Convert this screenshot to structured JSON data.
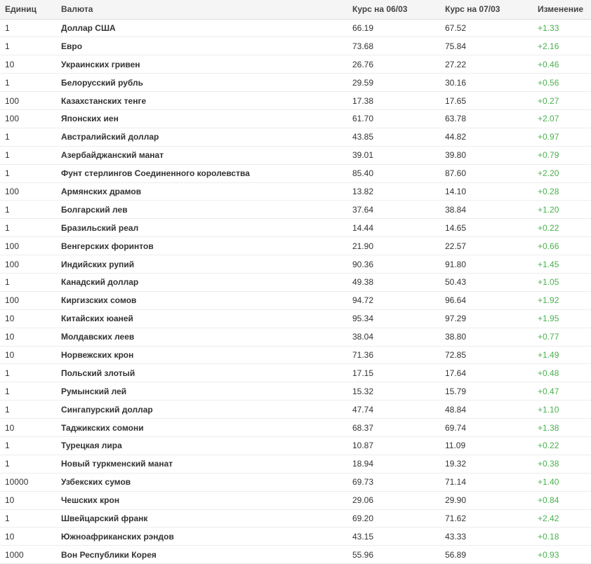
{
  "table": {
    "headers": {
      "units": "Единиц",
      "currency": "Валюта",
      "rate_prev": "Курс на 06/03",
      "rate_curr": "Курс на 07/03",
      "change": "Изменение"
    },
    "colors": {
      "change_positive": "#4caf50",
      "header_bg": "#f5f5f5"
    },
    "rows": [
      {
        "units": "1",
        "currency": "Доллар США",
        "rate_prev": "66.19",
        "rate_curr": "67.52",
        "change": "+1.33"
      },
      {
        "units": "1",
        "currency": "Евро",
        "rate_prev": "73.68",
        "rate_curr": "75.84",
        "change": "+2.16"
      },
      {
        "units": "10",
        "currency": "Украинских гривен",
        "rate_prev": "26.76",
        "rate_curr": "27.22",
        "change": "+0.46"
      },
      {
        "units": "1",
        "currency": "Белорусский рубль",
        "rate_prev": "29.59",
        "rate_curr": "30.16",
        "change": "+0.56"
      },
      {
        "units": "100",
        "currency": "Казахстанских тенге",
        "rate_prev": "17.38",
        "rate_curr": "17.65",
        "change": "+0.27"
      },
      {
        "units": "100",
        "currency": "Японских иен",
        "rate_prev": "61.70",
        "rate_curr": "63.78",
        "change": "+2.07"
      },
      {
        "units": "1",
        "currency": "Австралийский доллар",
        "rate_prev": "43.85",
        "rate_curr": "44.82",
        "change": "+0.97"
      },
      {
        "units": "1",
        "currency": "Азербайджанский манат",
        "rate_prev": "39.01",
        "rate_curr": "39.80",
        "change": "+0.79"
      },
      {
        "units": "1",
        "currency": "Фунт стерлингов Соединенного королевства",
        "rate_prev": "85.40",
        "rate_curr": "87.60",
        "change": "+2.20"
      },
      {
        "units": "100",
        "currency": "Армянских драмов",
        "rate_prev": "13.82",
        "rate_curr": "14.10",
        "change": "+0.28"
      },
      {
        "units": "1",
        "currency": "Болгарский лев",
        "rate_prev": "37.64",
        "rate_curr": "38.84",
        "change": "+1.20"
      },
      {
        "units": "1",
        "currency": "Бразильский реал",
        "rate_prev": "14.44",
        "rate_curr": "14.65",
        "change": "+0.22"
      },
      {
        "units": "100",
        "currency": "Венгерских форинтов",
        "rate_prev": "21.90",
        "rate_curr": "22.57",
        "change": "+0.66"
      },
      {
        "units": "100",
        "currency": "Индийских рупий",
        "rate_prev": "90.36",
        "rate_curr": "91.80",
        "change": "+1.45"
      },
      {
        "units": "1",
        "currency": "Канадский доллар",
        "rate_prev": "49.38",
        "rate_curr": "50.43",
        "change": "+1.05"
      },
      {
        "units": "100",
        "currency": "Киргизских сомов",
        "rate_prev": "94.72",
        "rate_curr": "96.64",
        "change": "+1.92"
      },
      {
        "units": "10",
        "currency": "Китайских юаней",
        "rate_prev": "95.34",
        "rate_curr": "97.29",
        "change": "+1.95"
      },
      {
        "units": "10",
        "currency": "Молдавских леев",
        "rate_prev": "38.04",
        "rate_curr": "38.80",
        "change": "+0.77"
      },
      {
        "units": "10",
        "currency": "Норвежских крон",
        "rate_prev": "71.36",
        "rate_curr": "72.85",
        "change": "+1.49"
      },
      {
        "units": "1",
        "currency": "Польский злотый",
        "rate_prev": "17.15",
        "rate_curr": "17.64",
        "change": "+0.48"
      },
      {
        "units": "1",
        "currency": "Румынский лей",
        "rate_prev": "15.32",
        "rate_curr": "15.79",
        "change": "+0.47"
      },
      {
        "units": "1",
        "currency": "Сингапурский доллар",
        "rate_prev": "47.74",
        "rate_curr": "48.84",
        "change": "+1.10"
      },
      {
        "units": "10",
        "currency": "Таджикских сомони",
        "rate_prev": "68.37",
        "rate_curr": "69.74",
        "change": "+1.38"
      },
      {
        "units": "1",
        "currency": "Турецкая лира",
        "rate_prev": "10.87",
        "rate_curr": "11.09",
        "change": "+0.22"
      },
      {
        "units": "1",
        "currency": "Новый туркменский манат",
        "rate_prev": "18.94",
        "rate_curr": "19.32",
        "change": "+0.38"
      },
      {
        "units": "10000",
        "currency": "Узбекских сумов",
        "rate_prev": "69.73",
        "rate_curr": "71.14",
        "change": "+1.40"
      },
      {
        "units": "10",
        "currency": "Чешских крон",
        "rate_prev": "29.06",
        "rate_curr": "29.90",
        "change": "+0.84"
      },
      {
        "units": "1",
        "currency": "Швейцарский франк",
        "rate_prev": "69.20",
        "rate_curr": "71.62",
        "change": "+2.42"
      },
      {
        "units": "10",
        "currency": "Южноафриканских рэндов",
        "rate_prev": "43.15",
        "rate_curr": "43.33",
        "change": "+0.18"
      },
      {
        "units": "1000",
        "currency": "Вон Республики Корея",
        "rate_prev": "55.96",
        "rate_curr": "56.89",
        "change": "+0.93"
      }
    ]
  }
}
